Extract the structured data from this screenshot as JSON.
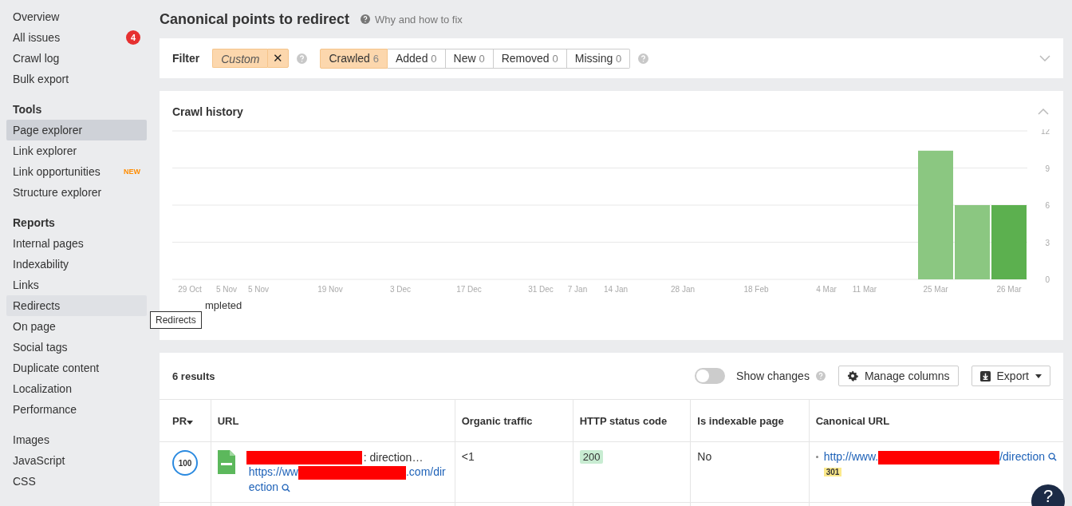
{
  "sidebar": {
    "sections": [
      {
        "items": [
          {
            "label": "Overview",
            "selected": false
          },
          {
            "label": "All issues",
            "selected": false,
            "badge": "4"
          },
          {
            "label": "Crawl log",
            "selected": false
          },
          {
            "label": "Bulk export",
            "selected": false
          }
        ]
      },
      {
        "heading": "Tools",
        "items": [
          {
            "label": "Page explorer",
            "selected": true
          },
          {
            "label": "Link explorer",
            "selected": false
          },
          {
            "label": "Link opportunities",
            "selected": false,
            "tag": "NEW"
          },
          {
            "label": "Structure explorer",
            "selected": false
          }
        ]
      },
      {
        "heading": "Reports",
        "items": [
          {
            "label": "Internal pages",
            "selected": false
          },
          {
            "label": "Indexability",
            "selected": false
          },
          {
            "label": "Links",
            "selected": false
          },
          {
            "label": "Redirects",
            "selected": false,
            "hovered": true
          },
          {
            "label": "On page",
            "selected": false
          },
          {
            "label": "Social tags",
            "selected": false
          },
          {
            "label": "Duplicate content",
            "selected": false
          },
          {
            "label": "Localization",
            "selected": false
          },
          {
            "label": "Performance",
            "selected": false
          }
        ]
      },
      {
        "items": [
          {
            "label": "Images",
            "selected": false
          },
          {
            "label": "JavaScript",
            "selected": false
          },
          {
            "label": "CSS",
            "selected": false
          }
        ]
      }
    ]
  },
  "tooltip": "Redirects",
  "page": {
    "title": "Canonical points to redirect",
    "help_link": "Why and how to fix"
  },
  "filter": {
    "label": "Filter",
    "custom_chip": "Custom",
    "clear": "✕",
    "segments": [
      {
        "label": "Crawled",
        "count": "6",
        "selected": true
      },
      {
        "label": "Added",
        "count": "0",
        "selected": false
      },
      {
        "label": "New",
        "count": "0",
        "selected": false
      },
      {
        "label": "Removed",
        "count": "0",
        "selected": false
      },
      {
        "label": "Missing",
        "count": "0",
        "selected": false
      }
    ]
  },
  "crawl_history": {
    "title": "Crawl history",
    "legend": "mpleted",
    "chart_data": {
      "type": "bar",
      "grid": true,
      "ylim": [
        0,
        12
      ],
      "yticks": [
        0,
        3,
        6,
        9,
        12
      ],
      "categories": [
        "29 Oct",
        "5 Nov",
        "5 Nov",
        "19 Nov",
        "3 Dec",
        "17 Dec",
        "31 Dec",
        "7 Jan",
        "14 Jan",
        "28 Jan",
        "18 Feb",
        "4 Mar",
        "11 Mar",
        "25 Mar",
        null,
        "26 Mar"
      ],
      "series": [
        {
          "color": "#8bc781",
          "values": [
            null,
            null,
            null,
            null,
            null,
            null,
            null,
            null,
            null,
            null,
            null,
            null,
            null,
            10.4,
            6,
            null
          ]
        },
        {
          "color": "#5cb04f",
          "values": [
            null,
            null,
            null,
            null,
            null,
            null,
            null,
            null,
            null,
            null,
            null,
            null,
            null,
            null,
            null,
            6
          ]
        }
      ]
    }
  },
  "results": {
    "count": "6 results",
    "toggle": {
      "label": "Show changes",
      "on": false
    },
    "manage_button": "Manage columns",
    "export_button": "Export",
    "columns": [
      {
        "label": "PR",
        "sorted": true
      },
      {
        "label": "URL",
        "sorted": false
      },
      {
        "label": "Organic traffic",
        "sorted": false
      },
      {
        "label": "HTTP status code",
        "sorted": false
      },
      {
        "label": "Is indexable page",
        "sorted": false
      },
      {
        "label": "Canonical URL",
        "sorted": false
      }
    ],
    "rows": [
      {
        "pr": "100",
        "title_suffix": ": direction…",
        "url_prefix": "https://ww",
        "url_suffix": ".com/direction",
        "organic": "<1",
        "status": "200",
        "indexable": "No",
        "canonical_prefix": "http://www.",
        "canonical_suffix": "/direction",
        "canonical_status": "301"
      }
    ]
  },
  "help_button": "?"
}
